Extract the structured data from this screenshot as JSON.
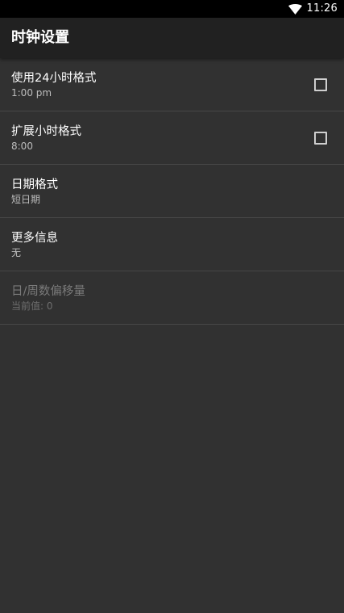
{
  "status_bar": {
    "time": "11:26",
    "icons": [
      "wifi-icon"
    ]
  },
  "app_bar": {
    "title": "时钟设置"
  },
  "colors": {
    "background": "#313131",
    "app_bar": "#212121",
    "status_bar": "#000000",
    "divider": "#474747",
    "text_primary": "#ffffff",
    "text_secondary": "#bdbdbd",
    "text_disabled": "#7a7a7a"
  },
  "preferences": [
    {
      "title": "使用24小时格式",
      "summary": "1:00 pm",
      "has_checkbox": true,
      "checked": false,
      "enabled": true
    },
    {
      "title": "扩展小时格式",
      "summary": "8:00",
      "has_checkbox": true,
      "checked": false,
      "enabled": true
    },
    {
      "title": "日期格式",
      "summary": "短日期",
      "has_checkbox": false,
      "enabled": true
    },
    {
      "title": "更多信息",
      "summary": "无",
      "has_checkbox": false,
      "enabled": true
    },
    {
      "title": "日/周数偏移量",
      "summary": "当前值: 0",
      "has_checkbox": false,
      "enabled": false
    }
  ]
}
